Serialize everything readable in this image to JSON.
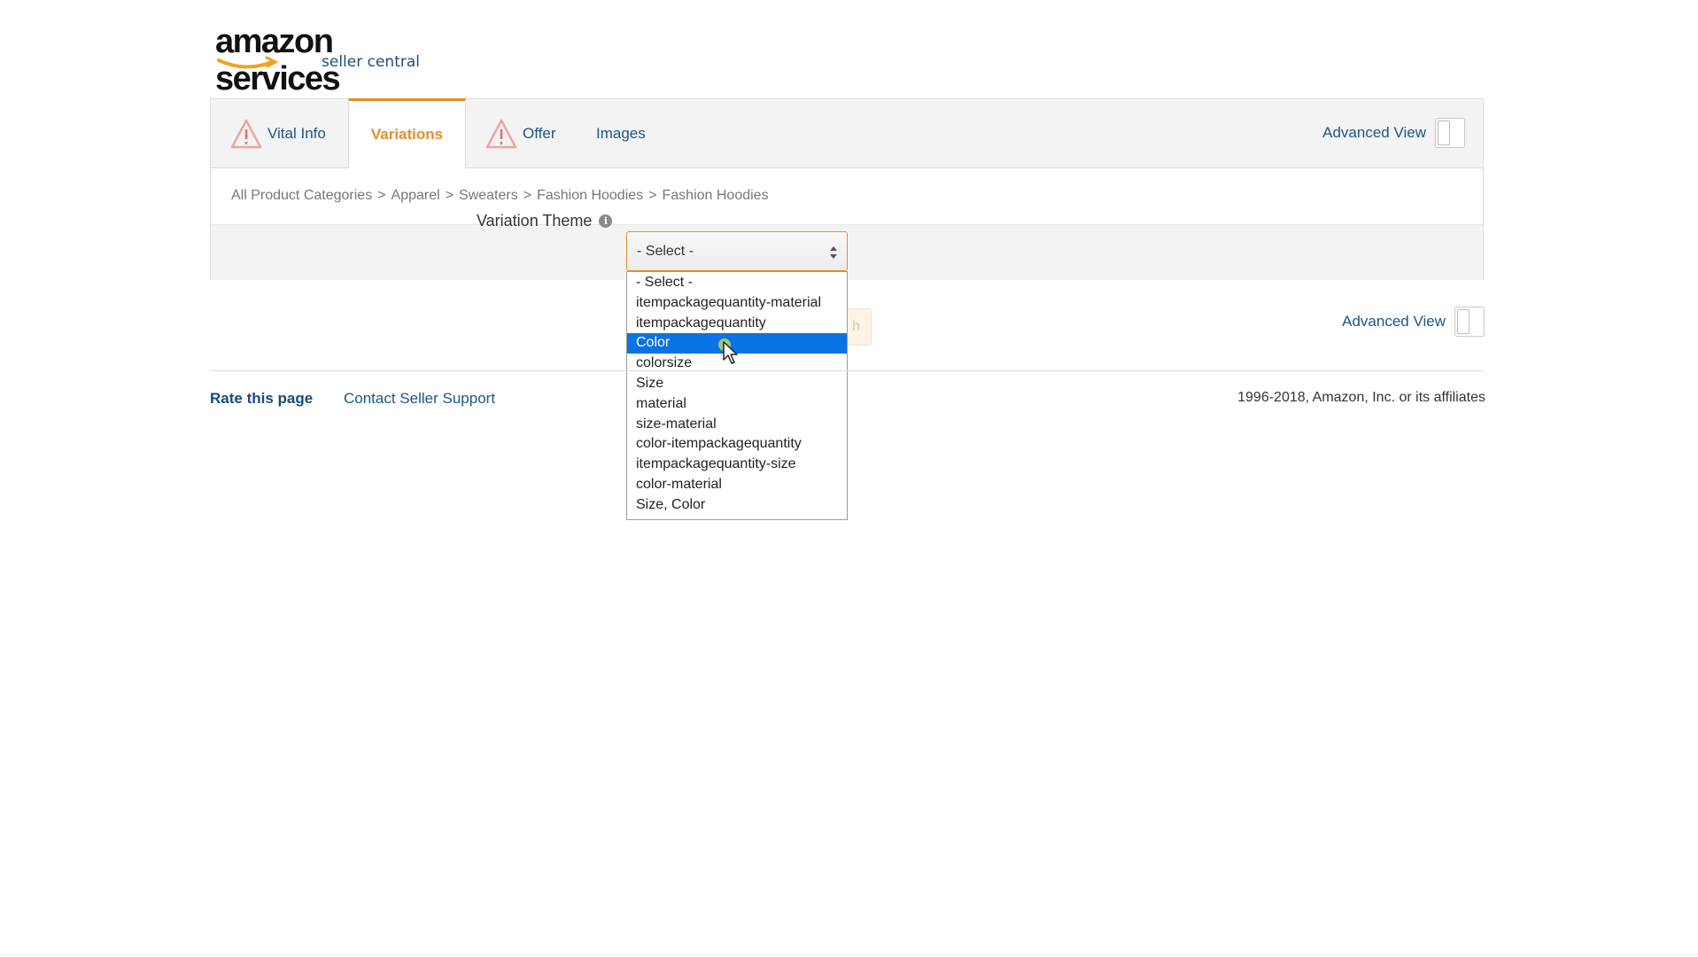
{
  "logo": {
    "brand": "amazon services",
    "sub": "seller central"
  },
  "tabs": [
    {
      "label": "Vital Info",
      "warning": true
    },
    {
      "label": "Variations",
      "warning": false,
      "active": true
    },
    {
      "label": "Offer",
      "warning": true
    },
    {
      "label": "Images",
      "warning": false
    }
  ],
  "advanced_view_label": "Advanced View",
  "breadcrumb": [
    "All Product Categories",
    "Apparel",
    "Sweaters",
    "Fashion Hoodies",
    "Fashion Hoodies"
  ],
  "breadcrumb_sep": ">",
  "variation_theme": {
    "label": "Variation Theme",
    "info_icon": "i",
    "selected_value": "- Select -",
    "highlighted_option": "Color",
    "options": [
      "- Select -",
      "itempackagequantity-material",
      "itempackagequantity",
      "Color",
      "colorsize",
      "Size",
      "material",
      "size-material",
      "color-itempackagequantity",
      "itempackagequantity-size",
      "color-material",
      "Size, Color"
    ]
  },
  "hidden_button_text": "h",
  "footer": {
    "rate": "Rate this page",
    "contact": "Contact Seller Support",
    "copyright": "1996-2018, Amazon, Inc. or its affiliates"
  },
  "colors": {
    "accent_orange": "#e2902c",
    "link_blue": "#1a5687",
    "highlight_blue": "#0a73e6"
  }
}
